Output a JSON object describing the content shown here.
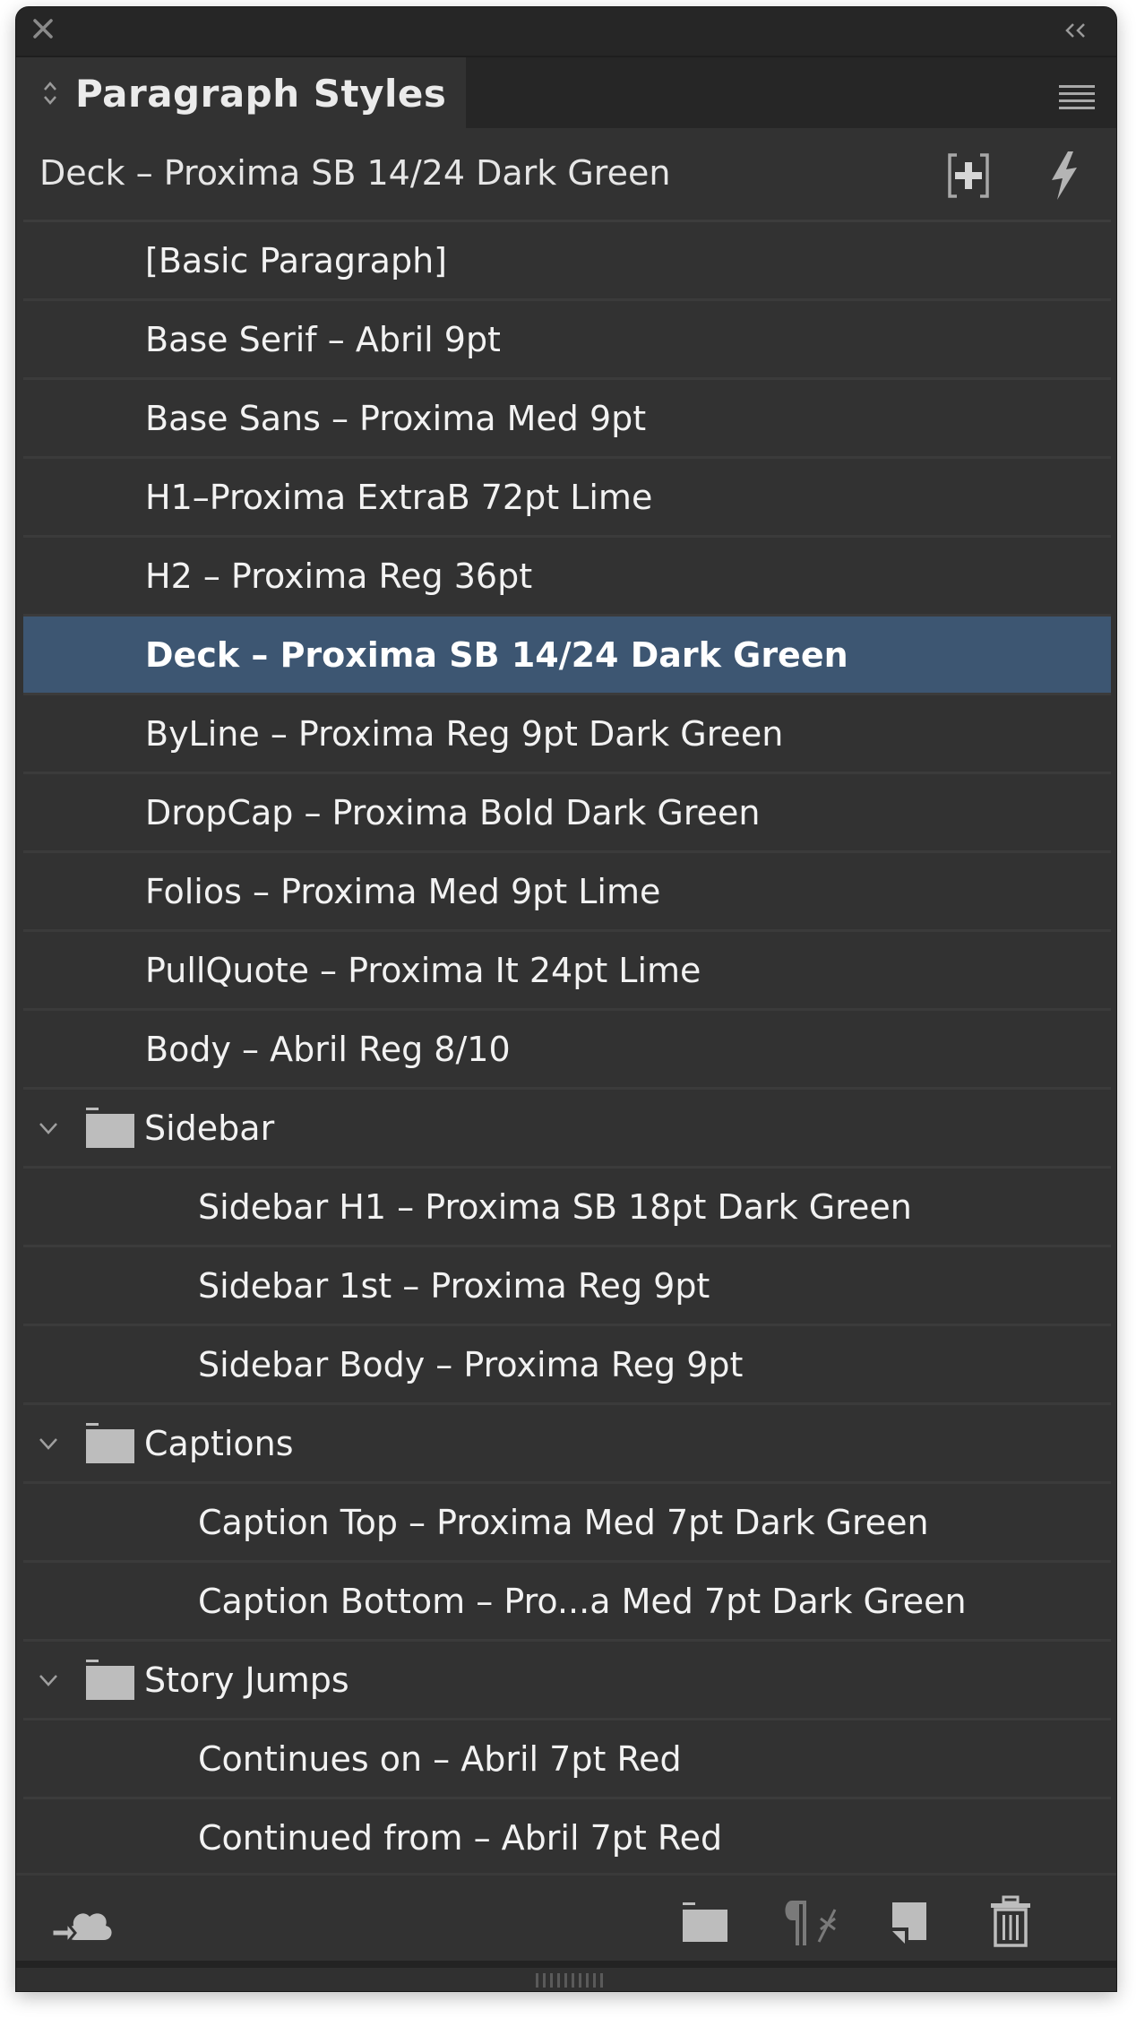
{
  "window": {
    "close_icon": "close-icon",
    "collapse_icon": "double-chevron-left-icon"
  },
  "tab": {
    "title": "Paragraph Styles",
    "arrows_icon": "up-down-arrows-icon",
    "menu_icon": "panel-menu-icon"
  },
  "header": {
    "current_style": "Deck – Proxima SB 14/24 Dark Green",
    "add_button_icon": "create-style-group-icon",
    "quick_apply_icon": "lightning-bolt-icon"
  },
  "colors": {
    "panel_bg": "#323232",
    "titlebar_bg": "#262626",
    "selected_row": "#3d5672",
    "text": "#f2f2f2",
    "icon": "#bdbdbd"
  },
  "styles": [
    {
      "label": "[Basic Paragraph]",
      "type": "item",
      "level": 0
    },
    {
      "label": "Base Serif – Abril 9pt",
      "type": "item",
      "level": 0
    },
    {
      "label": "Base Sans – Proxima Med 9pt",
      "type": "item",
      "level": 0
    },
    {
      "label": "H1–Proxima ExtraB 72pt Lime",
      "type": "item",
      "level": 0
    },
    {
      "label": "H2 – Proxima Reg 36pt",
      "type": "item",
      "level": 0
    },
    {
      "label": "Deck – Proxima SB 14/24 Dark Green",
      "type": "item",
      "level": 0,
      "selected": true
    },
    {
      "label": "ByLine – Proxima Reg 9pt Dark Green",
      "type": "item",
      "level": 0
    },
    {
      "label": "DropCap – Proxima Bold Dark Green",
      "type": "item",
      "level": 0
    },
    {
      "label": "Folios – Proxima Med 9pt Lime",
      "type": "item",
      "level": 0
    },
    {
      "label": "PullQuote – Proxima It 24pt Lime",
      "type": "item",
      "level": 0
    },
    {
      "label": "Body – Abril Reg 8/10",
      "type": "item",
      "level": 0
    },
    {
      "label": "Sidebar",
      "type": "group",
      "expanded": true
    },
    {
      "label": "Sidebar H1 – Proxima SB 18pt Dark Green",
      "type": "item",
      "level": 1
    },
    {
      "label": "Sidebar 1st – Proxima Reg 9pt",
      "type": "item",
      "level": 1
    },
    {
      "label": "Sidebar Body – Proxima Reg 9pt",
      "type": "item",
      "level": 1
    },
    {
      "label": "Captions",
      "type": "group",
      "expanded": true
    },
    {
      "label": "Caption Top – Proxima Med 7pt Dark Green",
      "type": "item",
      "level": 1
    },
    {
      "label": "Caption Bottom – Pro...a Med 7pt Dark Green",
      "type": "item",
      "level": 1
    },
    {
      "label": "Story Jumps",
      "type": "group",
      "expanded": true
    },
    {
      "label": "Continues on – Abril 7pt Red",
      "type": "item",
      "level": 1
    },
    {
      "label": "Continued from – Abril 7pt Red",
      "type": "item",
      "level": 1
    }
  ],
  "footer": {
    "buttons": [
      {
        "name": "cc-libraries-icon"
      },
      {
        "name": "new-style-group-icon"
      },
      {
        "name": "clear-overrides-icon",
        "disabled": true
      },
      {
        "name": "new-style-icon"
      },
      {
        "name": "delete-icon"
      }
    ]
  }
}
